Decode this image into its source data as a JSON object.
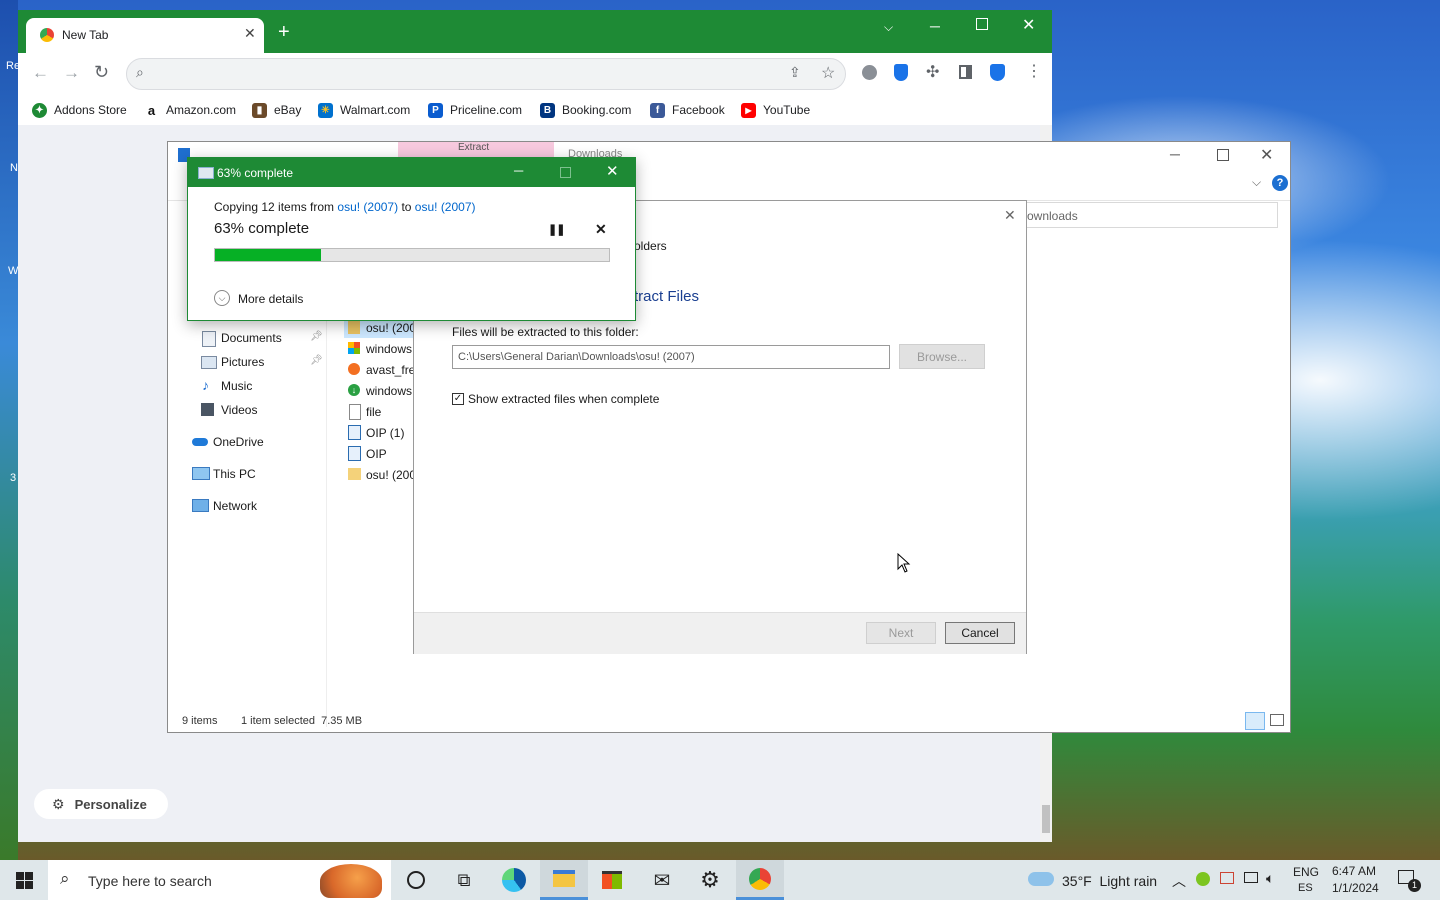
{
  "desktop": {
    "left_icon_texts": [
      "Re",
      "N",
      "W",
      "3"
    ]
  },
  "chrome": {
    "tab_title": "New Tab",
    "new_tab_symbol": "+",
    "omnibox_placeholder": "",
    "bookmarks": [
      {
        "label": "Addons Store",
        "icon": "addons-store-icon",
        "color": "#1e8a35"
      },
      {
        "label": "Amazon.com",
        "icon": "amazon-icon",
        "color": "#222222"
      },
      {
        "label": "eBay",
        "icon": "ebay-icon",
        "color": "#e53238"
      },
      {
        "label": "Walmart.com",
        "icon": "walmart-icon",
        "color": "#0071ce"
      },
      {
        "label": "Priceline.com",
        "icon": "priceline-icon",
        "color": "#0a5ccf"
      },
      {
        "label": "Booking.com",
        "icon": "booking-icon",
        "color": "#003580"
      },
      {
        "label": "Facebook",
        "icon": "facebook-icon",
        "color": "#3b5998"
      },
      {
        "label": "YouTube",
        "icon": "youtube-icon",
        "color": "#ff0000"
      }
    ],
    "personalize_label": "Personalize",
    "accent": "#1e8a35"
  },
  "explorer": {
    "tab_partial_1": "Extract",
    "tab_partial_2": "Downloads",
    "address_partial": "ownloads",
    "nav_items": [
      {
        "label": "Documents",
        "icon": "documents-icon",
        "pinned": true
      },
      {
        "label": "Pictures",
        "icon": "pictures-icon",
        "pinned": true
      },
      {
        "label": "Music",
        "icon": "music-icon",
        "pinned": false
      },
      {
        "label": "Videos",
        "icon": "videos-icon",
        "pinned": false
      },
      {
        "label": "OneDrive",
        "icon": "onedrive-icon",
        "pinned": false
      },
      {
        "label": "This PC",
        "icon": "this-pc-icon",
        "pinned": false
      },
      {
        "label": "Network",
        "icon": "network-icon",
        "pinned": false
      }
    ],
    "files": [
      {
        "label": "osu! (200",
        "icon": "zip-folder-icon",
        "selected": true
      },
      {
        "label": "windows",
        "icon": "windows-installer-icon",
        "selected": false
      },
      {
        "label": "avast_fre",
        "icon": "avast-icon",
        "selected": false
      },
      {
        "label": "windows",
        "icon": "download-icon",
        "selected": false
      },
      {
        "label": "file",
        "icon": "file-icon",
        "selected": false
      },
      {
        "label": "OIP (1)",
        "icon": "image-file-icon",
        "selected": false
      },
      {
        "label": "OIP",
        "icon": "image-file-icon",
        "selected": false
      },
      {
        "label": "osu! (200",
        "icon": "folder-icon",
        "selected": false
      }
    ],
    "status_items": "9 items",
    "status_selected": "1 item selected  7.35 MB"
  },
  "extract": {
    "partial_breadcrumb": "olders",
    "heading": "tract Files",
    "folder_label": "Files will be extracted to this folder:",
    "folder_path": "C:\\Users\\General Darian\\Downloads\\osu! (2007)",
    "browse_label": "Browse...",
    "show_files_label": "Show extracted files when complete",
    "show_files_checked": true,
    "next_label": "Next",
    "cancel_label": "Cancel"
  },
  "copy": {
    "title": "63% complete",
    "copying_prefix": "Copying 12 items from",
    "source": "osu! (2007)",
    "to_word": "to",
    "dest": "osu! (2007)",
    "percent_text": "63% complete",
    "progress": 0.27,
    "more_details": "More details",
    "progress_color": "#06b025"
  },
  "taskbar": {
    "search_placeholder": "Type here to search",
    "weather": "35°F  Light rain",
    "lang_top": "ENG",
    "lang_bottom": "ES",
    "time": "6:47 AM",
    "date": "1/1/2024",
    "notif_count": "1"
  }
}
